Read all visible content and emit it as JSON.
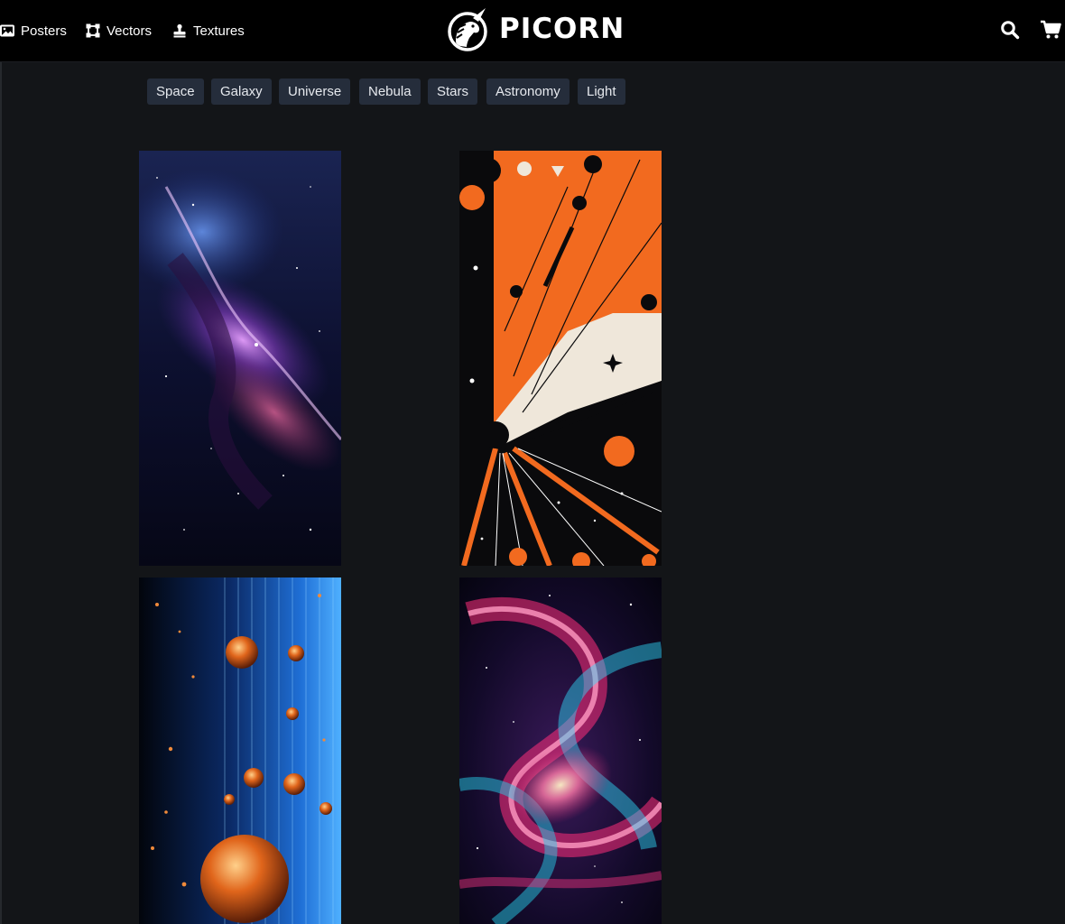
{
  "nav": {
    "posters": {
      "label": "Posters",
      "icon": "image-icon"
    },
    "vectors": {
      "label": "Vectors",
      "icon": "vector-square-icon"
    },
    "textures": {
      "label": "Textures",
      "icon": "stamp-icon"
    }
  },
  "brand": {
    "name": "PICORN",
    "logo_icon": "unicorn-logo-icon"
  },
  "actions": {
    "search_icon": "search-icon",
    "cart_icon": "shopping-cart-icon"
  },
  "tags": [
    "Space",
    "Galaxy",
    "Universe",
    "Nebula",
    "Stars",
    "Astronomy",
    "Light"
  ],
  "gallery": [
    {
      "subject": "purple nebula"
    },
    {
      "subject": "orange and black retro space burst"
    },
    {
      "subject": "glowing orange spheres on blue"
    },
    {
      "subject": "pink and cyan swirl galaxy"
    }
  ],
  "colors": {
    "header_bg": "#000000",
    "page_bg": "#131518",
    "tag_bg": "#252d3b"
  }
}
